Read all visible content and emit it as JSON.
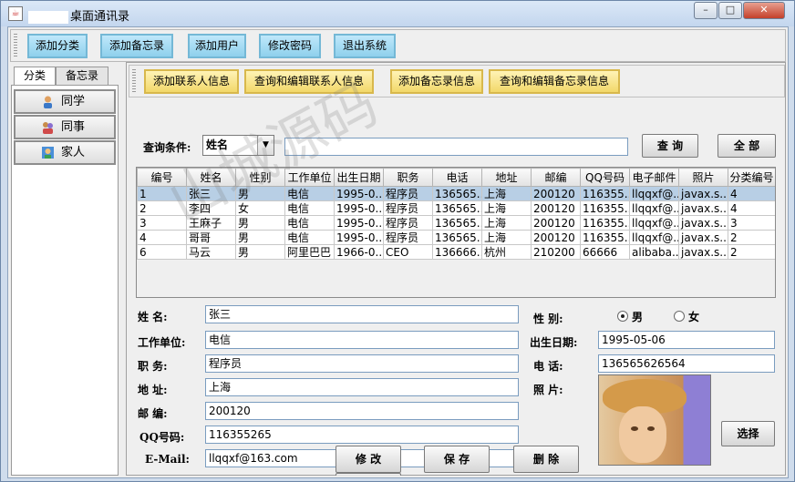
{
  "window": {
    "title": "桌面通讯录",
    "buttons": {
      "minimize": "–",
      "maximize": "□",
      "close": "✕"
    }
  },
  "toolbar": {
    "add_category": "添加分类",
    "add_memo": "添加备忘录",
    "add_user": "添加用户",
    "change_password": "修改密码",
    "exit": "退出系统"
  },
  "left_tabs": {
    "category": "分类",
    "memo": "备忘录"
  },
  "categories": [
    {
      "label": "同学",
      "icon": "classmate-icon"
    },
    {
      "label": "同事",
      "icon": "colleague-icon"
    },
    {
      "label": "家人",
      "icon": "family-icon"
    }
  ],
  "contact_toolbar": {
    "add_contact": "添加联系人信息",
    "query_contact": "查询和编辑联系人信息",
    "add_memo_info": "添加备忘录信息",
    "query_memo": "查询和编辑备忘录信息"
  },
  "search": {
    "label": "查询条件:",
    "field_selected": "姓名",
    "value": "",
    "query_button": "查 询",
    "all_button": "全 部"
  },
  "table": {
    "columns": [
      "编号",
      "姓名",
      "性别",
      "工作单位",
      "出生日期",
      "职务",
      "电话",
      "地址",
      "邮编",
      "QQ号码",
      "电子邮件",
      "照片",
      "分类编号"
    ],
    "rows": [
      [
        "1",
        "张三",
        "男",
        "电信",
        "1995-0...",
        "程序员",
        "136565...",
        "上海",
        "200120",
        "116355...",
        "llqqxf@...",
        "javax.s...",
        "4"
      ],
      [
        "2",
        "李四",
        "女",
        "电信",
        "1995-0...",
        "程序员",
        "136565...",
        "上海",
        "200120",
        "116355...",
        "llqqxf@...",
        "javax.s...",
        "4"
      ],
      [
        "3",
        "王麻子",
        "男",
        "电信",
        "1995-0...",
        "程序员",
        "136565...",
        "上海",
        "200120",
        "116355...",
        "llqqxf@...",
        "javax.s...",
        "3"
      ],
      [
        "4",
        "哥哥",
        "男",
        "电信",
        "1995-0...",
        "程序员",
        "136565...",
        "上海",
        "200120",
        "116355...",
        "llqqxf@...",
        "javax.s...",
        "2"
      ],
      [
        "6",
        "马云",
        "男",
        "阿里巴巴",
        "1966-0...",
        "CEO",
        "136666...",
        "杭州",
        "210200",
        "66666",
        "alibaba...",
        "javax.s...",
        "2"
      ]
    ]
  },
  "form": {
    "name_label": "姓    名:",
    "name_value": "张三",
    "gender_label": "性  别:",
    "gender_male": "男",
    "gender_female": "女",
    "work_label": "工作单位:",
    "work_value": "电信",
    "birth_label": "出生日期:",
    "birth_value": "1995-05-06",
    "job_label": "职    务:",
    "job_value": "程序员",
    "phone_label": "电  话:",
    "phone_value": "136565626564",
    "address_label": "地    址:",
    "address_value": "上海",
    "photo_label": "照  片:",
    "zip_label": "邮    编:",
    "zip_value": "200120",
    "qq_label": "QQ号码:",
    "qq_value": "116355265",
    "email_label": "E-Mail:",
    "email_value": "llqqxf@163.com",
    "choose_button": "选择",
    "modify_button": "修  改",
    "save_button": "保  存",
    "delete_button": "删  除"
  },
  "watermark": "山城源码"
}
